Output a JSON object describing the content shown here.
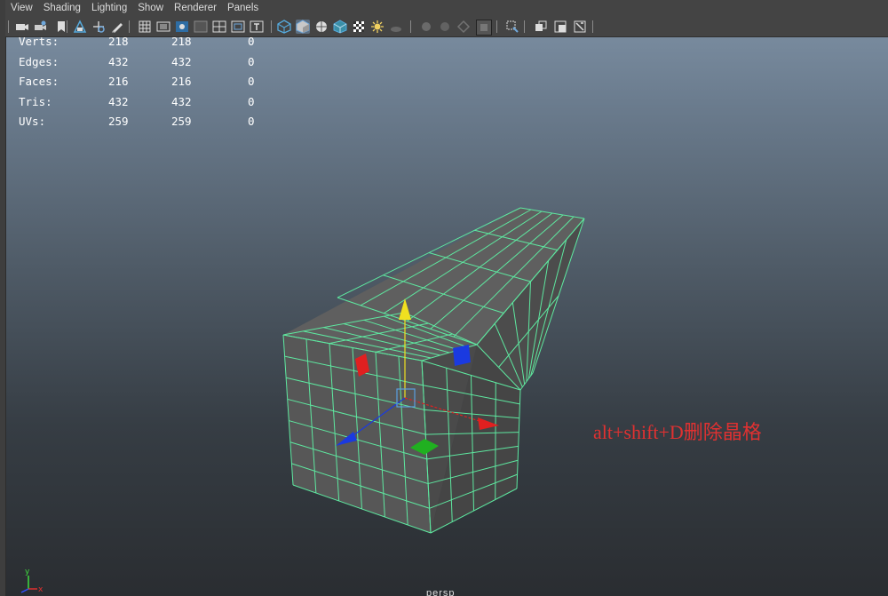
{
  "menu": {
    "items": [
      "View",
      "Shading",
      "Lighting",
      "Show",
      "Renderer",
      "Panels"
    ]
  },
  "toolbar": {
    "icons": [
      "camera-icon",
      "camera-attributes-icon",
      "bookmark-icon",
      "image-plane-icon",
      "pan-zoom-icon",
      "grease-pencil-icon",
      "grid-icon",
      "film-gate-icon",
      "resolution-gate-icon",
      "gate-mask-icon",
      "field-chart-icon",
      "safe-action-icon",
      "safe-title-icon",
      "wireframe-icon",
      "smooth-shade-icon",
      "wireframe-on-shaded-icon",
      "textured-icon",
      "use-all-lights-icon",
      "shadows-icon",
      "ambient-occlusion-icon",
      "motion-blur-icon",
      "anti-aliasing-icon",
      "depth-of-field-icon",
      "isolate-select-icon",
      "xray-icon",
      "xray-joints-icon",
      "xray-components-icon"
    ]
  },
  "hud": {
    "rows": [
      {
        "label": "Verts:",
        "a": "218",
        "b": "218",
        "c": "0"
      },
      {
        "label": "Edges:",
        "a": "432",
        "b": "432",
        "c": "0"
      },
      {
        "label": "Faces:",
        "a": "216",
        "b": "216",
        "c": "0"
      },
      {
        "label": "Tris:",
        "a": "432",
        "b": "432",
        "c": "0"
      },
      {
        "label": "UVs:",
        "a": "259",
        "b": "259",
        "c": "0"
      }
    ]
  },
  "annotation": {
    "text": "alt+shift+D删除晶格",
    "color": "#e03131"
  },
  "axis": {
    "y_label": "y",
    "x_label": "x",
    "y_color": "#3fdc3f",
    "x_color": "#e03030",
    "z_color": "#3050ff"
  },
  "camera": {
    "label": "persp"
  },
  "mesh": {
    "wire_color": "#5ee8a0",
    "face_color": "#5a5a5a"
  },
  "manipulator": {
    "y_color": "#f0e020",
    "x_color": "#e02020",
    "z_color": "#1a3ae0",
    "xz_plane_color": "#20b020"
  }
}
